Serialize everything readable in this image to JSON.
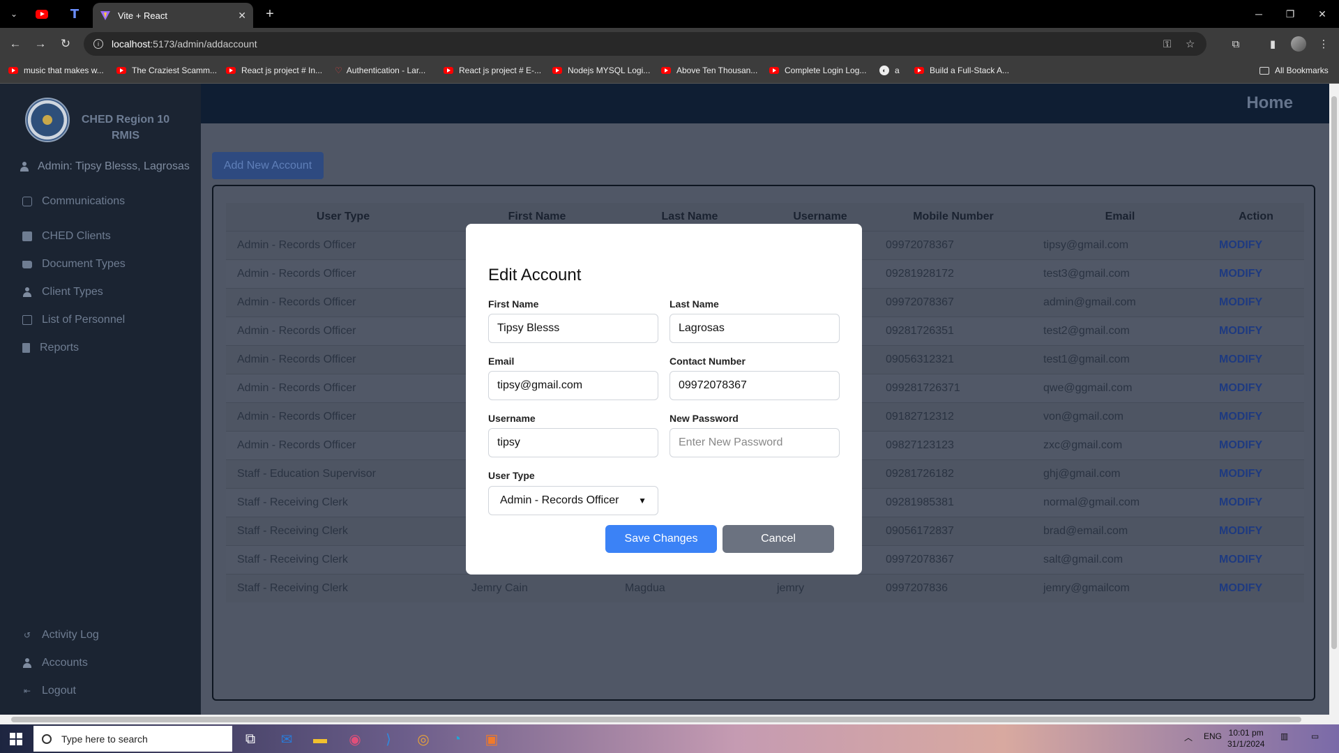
{
  "browser": {
    "active_tab_title": "Vite + React",
    "url_host": "localhost",
    "url_path": ":5173/admin/addaccount",
    "bookmarks": [
      "music that makes w...",
      "The Craziest Scamm...",
      "React js project # In...",
      "Authentication - Lar...",
      "React js project # E-...",
      "Nodejs MYSQL Logi...",
      "Above Ten Thousan...",
      "Complete Login Log...",
      "a",
      "Build a Full-Stack A..."
    ],
    "all_bookmarks": "All Bookmarks"
  },
  "sidebar": {
    "org_name": "CHED Region 10 RMIS",
    "admin_label": "Admin: Tipsy Blesss, Lagrosas",
    "items": [
      {
        "label": "Communications",
        "icon": "message-icon"
      },
      {
        "label": "CHED Clients",
        "icon": "clients-icon"
      },
      {
        "label": "Document Types",
        "icon": "folder-icon"
      },
      {
        "label": "Client Types",
        "icon": "user-icon"
      },
      {
        "label": "List of Personnel",
        "icon": "list-icon"
      },
      {
        "label": "Reports",
        "icon": "file-icon"
      }
    ],
    "bottom_items": [
      {
        "label": "Activity Log",
        "icon": "history-icon"
      },
      {
        "label": "Accounts",
        "icon": "user-icon"
      },
      {
        "label": "Logout",
        "icon": "logout-icon"
      }
    ]
  },
  "header": {
    "title": "Home"
  },
  "add_button": "Add New Account",
  "table": {
    "headers": [
      "User Type",
      "First Name",
      "Last Name",
      "Username",
      "Mobile Number",
      "Email",
      "Action"
    ],
    "rows": [
      [
        "Admin - Records Officer",
        "",
        "",
        "",
        "09972078367",
        "tipsy@gmail.com",
        "MODIFY"
      ],
      [
        "Admin - Records Officer",
        "",
        "",
        "",
        "09281928172",
        "test3@gmail.com",
        "MODIFY"
      ],
      [
        "Admin - Records Officer",
        "",
        "",
        "",
        "09972078367",
        "admin@gmail.com",
        "MODIFY"
      ],
      [
        "Admin - Records Officer",
        "",
        "",
        "",
        "09281726351",
        "test2@gmail.com",
        "MODIFY"
      ],
      [
        "Admin - Records Officer",
        "",
        "",
        "",
        "09056312321",
        "test1@gmail.com",
        "MODIFY"
      ],
      [
        "Admin - Records Officer",
        "",
        "",
        "",
        "099281726371",
        "qwe@ggmail.com",
        "MODIFY"
      ],
      [
        "Admin - Records Officer",
        "",
        "",
        "",
        "09182712312",
        "von@gmail.com",
        "MODIFY"
      ],
      [
        "Admin - Records Officer",
        "",
        "",
        "",
        "09827123123",
        "zxc@gmail.com",
        "MODIFY"
      ],
      [
        "Staff - Education Supervisor",
        "",
        "",
        "",
        "09281726182",
        "ghj@gmail.com",
        "MODIFY"
      ],
      [
        "Staff - Receiving Clerk",
        "",
        "",
        "",
        "09281985381",
        "normal@gmail.com",
        "MODIFY"
      ],
      [
        "Staff - Receiving Clerk",
        "",
        "",
        "",
        "09056172837",
        "brad@email.com",
        "MODIFY"
      ],
      [
        "Staff - Receiving Clerk",
        "",
        "",
        "",
        "09972078367",
        "salt@gmail.com",
        "MODIFY"
      ],
      [
        "Staff - Receiving Clerk",
        "Jemry Cain",
        "Magdua",
        "jemry",
        "0997207836",
        "jemry@gmailcom",
        "MODIFY"
      ]
    ]
  },
  "modal": {
    "title": "Edit Account",
    "first_name_label": "First Name",
    "first_name_value": "Tipsy Blesss",
    "last_name_label": "Last Name",
    "last_name_value": "Lagrosas",
    "email_label": "Email",
    "email_value": "tipsy@gmail.com",
    "contact_label": "Contact Number",
    "contact_value": "09972078367",
    "username_label": "Username",
    "username_value": "tipsy",
    "password_label": "New Password",
    "password_placeholder": "Enter New Password",
    "user_type_label": "User Type",
    "user_type_value": "Admin - Records Officer",
    "save_label": "Save Changes",
    "cancel_label": "Cancel"
  },
  "taskbar": {
    "search_placeholder": "Type here to search",
    "language": "ENG",
    "time": "10:01 pm",
    "date": "31/1/2024"
  },
  "colors": {
    "sidebar_bg": "#1b2432",
    "topbar_bg": "#0f1e33",
    "save_button": "#3b82f6",
    "cancel_button": "#6b7280",
    "modify_link": "#1e3a80"
  }
}
